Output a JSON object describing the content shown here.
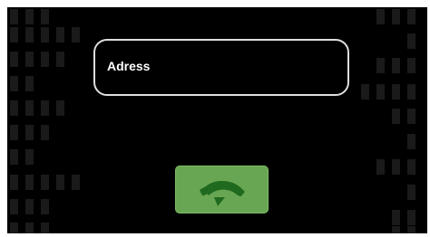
{
  "address_field": {
    "placeholder": "Adress"
  },
  "call_button": {
    "icon": "phone-call-icon",
    "color": "#69a653",
    "icon_color": "#1f6a1f"
  },
  "background": {
    "color": "#000000",
    "pattern_color": "#1a1a1a"
  }
}
